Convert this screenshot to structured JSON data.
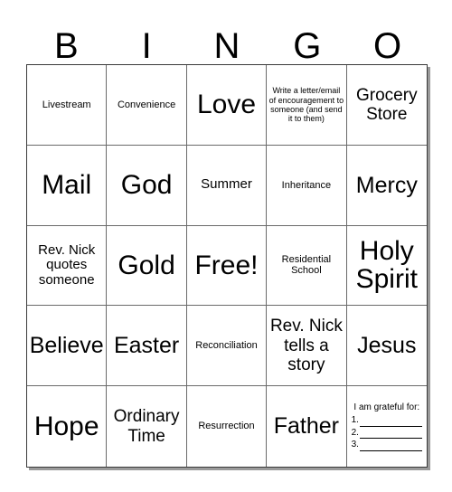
{
  "header": {
    "letters": [
      "B",
      "I",
      "N",
      "G",
      "O"
    ]
  },
  "grid": {
    "rows": [
      [
        {
          "text": "Livestream",
          "size": "fs-sm"
        },
        {
          "text": "Convenience",
          "size": "fs-sm"
        },
        {
          "text": "Love",
          "size": "fs-xxl"
        },
        {
          "text": "Write a letter/email of encouragement to someone (and send it to them)",
          "size": "fs-xs"
        },
        {
          "text": "Grocery Store",
          "size": "fs-lg"
        }
      ],
      [
        {
          "text": "Mail",
          "size": "fs-xxl"
        },
        {
          "text": "God",
          "size": "fs-xxl"
        },
        {
          "text": "Summer",
          "size": "fs-md"
        },
        {
          "text": "Inheritance",
          "size": "fs-sm"
        },
        {
          "text": "Mercy",
          "size": "fs-xl"
        }
      ],
      [
        {
          "text": "Rev. Nick quotes someone",
          "size": "fs-md"
        },
        {
          "text": "Gold",
          "size": "fs-xxl"
        },
        {
          "text": "Free!",
          "size": "fs-xxl"
        },
        {
          "text": "Residential School",
          "size": "fs-sm"
        },
        {
          "text": "Holy Spirit",
          "size": "fs-xxl"
        }
      ],
      [
        {
          "text": "Believe",
          "size": "fs-xl"
        },
        {
          "text": "Easter",
          "size": "fs-xl"
        },
        {
          "text": "Reconciliation",
          "size": "fs-sm"
        },
        {
          "text": "Rev. Nick tells a story",
          "size": "fs-lg"
        },
        {
          "text": "Jesus",
          "size": "fs-xl"
        }
      ],
      [
        {
          "text": "Hope",
          "size": "fs-xxl"
        },
        {
          "text": "Ordinary Time",
          "size": "fs-lg"
        },
        {
          "text": "Resurrection",
          "size": "fs-sm"
        },
        {
          "text": "Father",
          "size": "fs-xl"
        },
        {
          "type": "gratitude"
        }
      ]
    ]
  },
  "gratitude": {
    "title": "I am grateful for:",
    "items": [
      "1.",
      "2.",
      "3."
    ]
  },
  "colors": {
    "background": "#ffffff",
    "text": "#000000",
    "grid_line": "#6a6a6a",
    "grid_outer": "#3a3a3a",
    "shadow": "#9a9a9a"
  }
}
